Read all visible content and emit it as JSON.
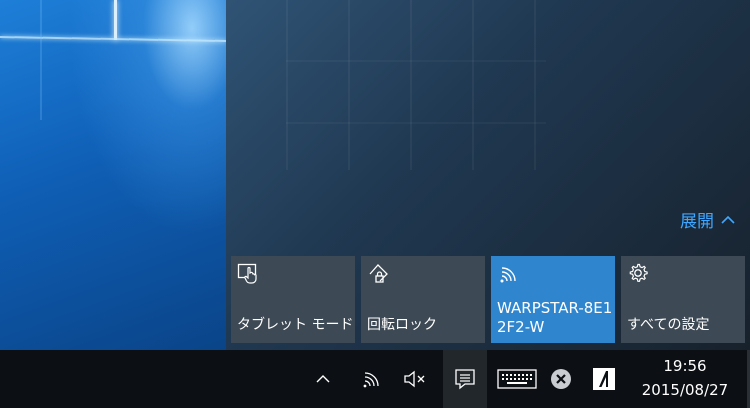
{
  "action_center": {
    "expand_label": "展開",
    "tiles": [
      {
        "label": "タブレット モード",
        "icon": "tablet-mode-icon",
        "active": false
      },
      {
        "label": "回転ロック",
        "icon": "rotation-lock-icon",
        "active": false
      },
      {
        "label": "WARPSTAR-8E12F2-W",
        "icon": "wifi-icon",
        "active": true
      },
      {
        "label": "すべての設定",
        "icon": "gear-icon",
        "active": false
      }
    ],
    "active_color": "#2f86cf",
    "tile_color": "#3d4954",
    "accent_color": "#3fa7ff"
  },
  "taskbar": {
    "time": "19:56",
    "date": "2015/08/27",
    "icons": [
      "chevron-up-icon",
      "network-icon",
      "volume-muted-icon",
      "notifications-icon",
      "keyboard-icon",
      "clear-icon",
      "app-icon"
    ]
  }
}
